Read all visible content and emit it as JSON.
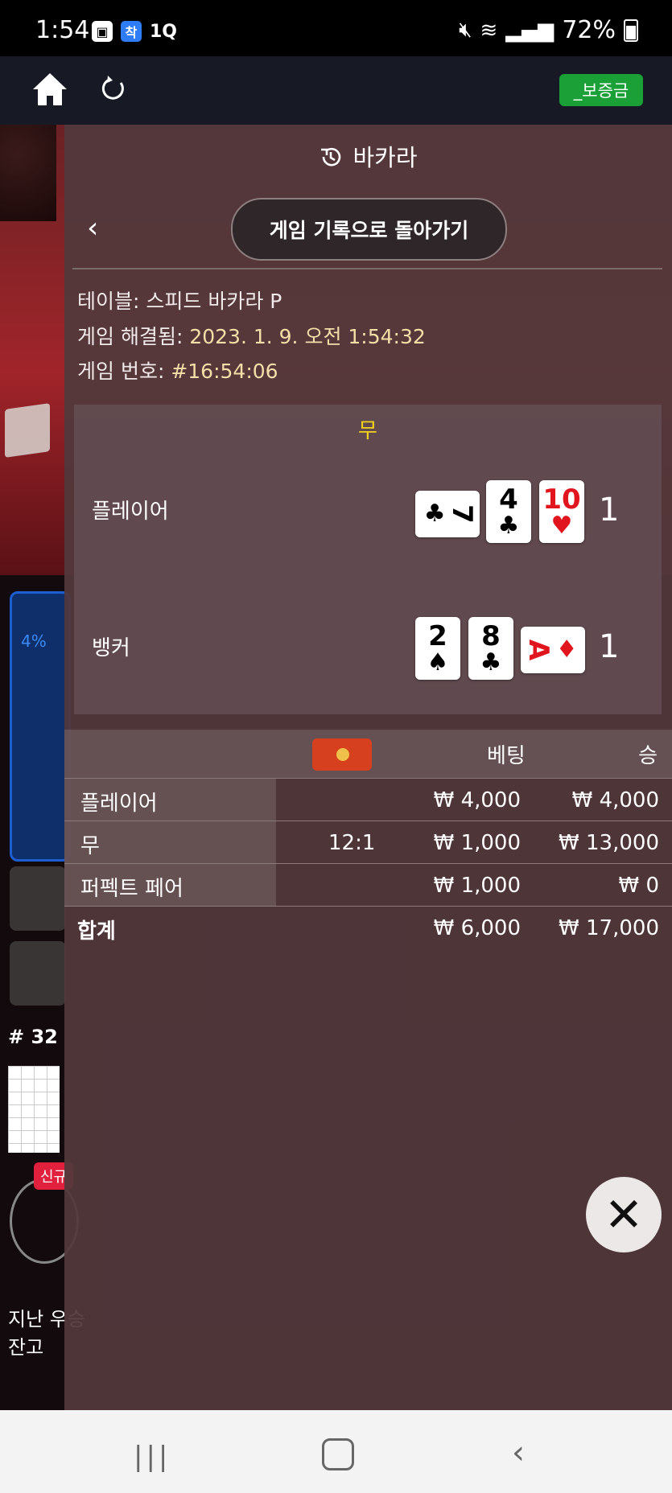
{
  "status_bar": {
    "time": "1:54",
    "left_icons": [
      "image-icon",
      "app-badge-icon",
      "1q-app-icon"
    ],
    "app_badge_text": "착",
    "app_text": "1Q",
    "battery": "72%"
  },
  "topnav": {
    "deposit_label": "_보증금"
  },
  "background": {
    "percent": "4%",
    "round_label": "# 32",
    "new_badge": "신규",
    "last_win_label": "지난 우승",
    "balance_label": "잔고"
  },
  "panel": {
    "title": "바카라",
    "return_label": "게임 기록으로 돌아가기",
    "table_label": "테이블:",
    "table_value": "스피드 바카라 P",
    "resolved_label": "게임 해결됨:",
    "resolved_value": "2023. 1. 9. 오전 1:54:32",
    "game_no_label": "게임 번호:",
    "game_no_value": "#16:54:06",
    "result": "무",
    "hands": [
      {
        "label": "플레이어",
        "score": "1",
        "cards": [
          {
            "rank": "7",
            "suit": "♣",
            "color": "#000000",
            "rotated": true
          },
          {
            "rank": "4",
            "suit": "♣",
            "color": "#000000",
            "rotated": false
          },
          {
            "rank": "10",
            "suit": "♥",
            "color": "#e0151d",
            "rotated": false
          }
        ]
      },
      {
        "label": "뱅커",
        "score": "1",
        "cards": [
          {
            "rank": "2",
            "suit": "♠",
            "color": "#000000",
            "rotated": false
          },
          {
            "rank": "8",
            "suit": "♣",
            "color": "#000000",
            "rotated": false
          },
          {
            "rank": "A",
            "suit": "♦",
            "color": "#e0151d",
            "rotated": true
          }
        ]
      }
    ],
    "bets_header": {
      "bet": "베팅",
      "win": "승"
    },
    "bets": [
      {
        "name": "플레이어",
        "odds": "",
        "bet": "₩ 4,000",
        "win": "₩ 4,000"
      },
      {
        "name": "무",
        "odds": "12:1",
        "bet": "₩ 1,000",
        "win": "₩ 13,000"
      },
      {
        "name": "퍼펙트 페어",
        "odds": "",
        "bet": "₩ 1,000",
        "win": "₩ 0"
      }
    ],
    "total": {
      "name": "합계",
      "bet": "₩ 6,000",
      "win": "₩ 17,000"
    }
  },
  "close_label": "✕",
  "navbar": {
    "recent": "|||",
    "back": "‹"
  }
}
